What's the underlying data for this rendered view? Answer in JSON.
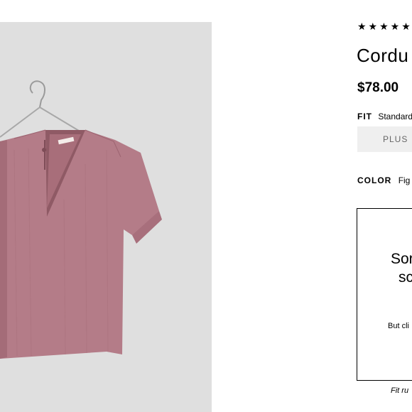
{
  "product": {
    "rating_stars": "★★★★★",
    "title": "Cordu",
    "price": "$78.00"
  },
  "fit": {
    "label": "FIT",
    "value": "Standard",
    "option_label": "PLUS"
  },
  "color": {
    "label": "COLOR",
    "value": "Fig"
  },
  "size_panel": {
    "heading_line1": "Sor",
    "heading_line2": "sc",
    "note": "But cli"
  },
  "fit_note": "Fit ru",
  "colors": {
    "shirt": "#b47c88",
    "photo_bg": "#dfdfdf",
    "button_bg": "#efefef"
  },
  "icons": {
    "rating": "star-icon"
  }
}
